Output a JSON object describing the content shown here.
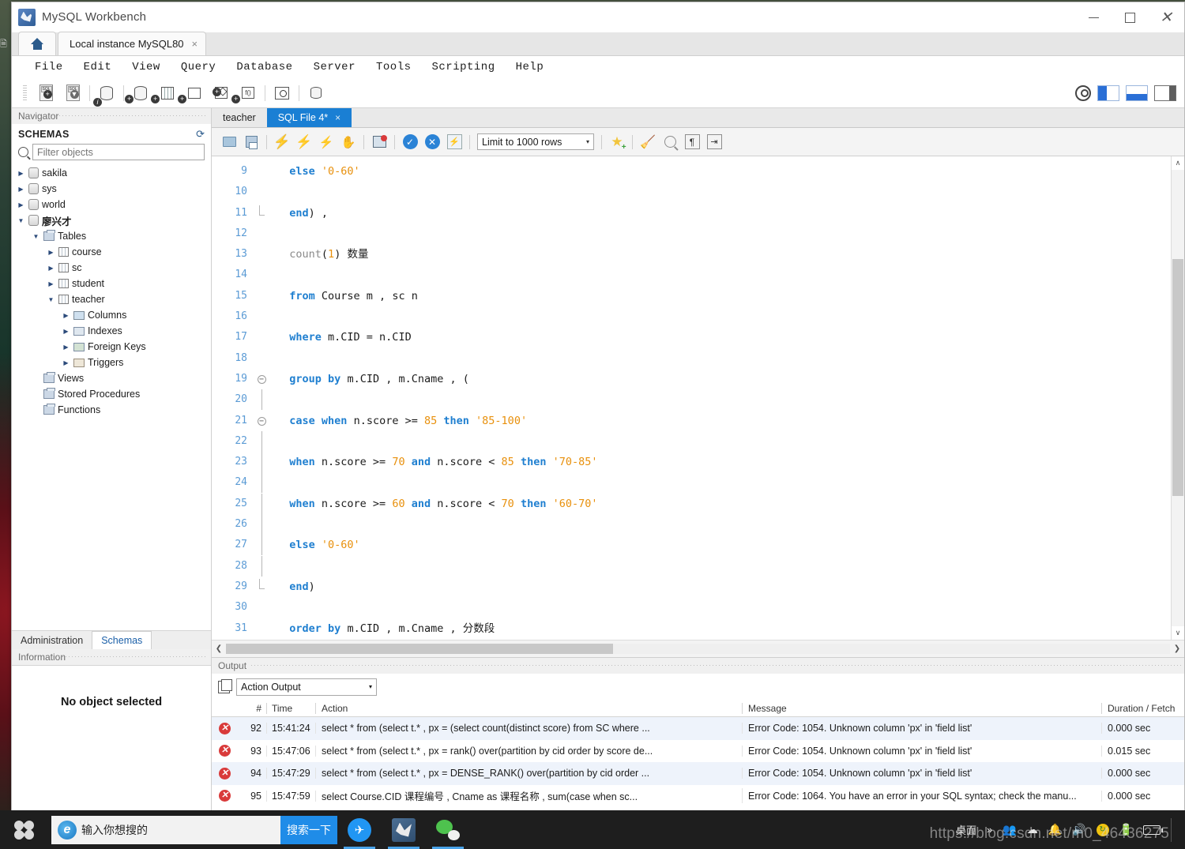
{
  "window": {
    "title": "MySQL Workbench",
    "controls": {
      "minimize": "—",
      "maximize": "□",
      "close": "✕"
    }
  },
  "connection_tabs": {
    "home_label": "home-tab",
    "active_tab": "Local instance MySQL80",
    "close_glyph": "×"
  },
  "menubar": {
    "items": [
      "File",
      "Edit",
      "View",
      "Query",
      "Database",
      "Server",
      "Tools",
      "Scripting",
      "Help"
    ]
  },
  "main_toolbar": {
    "icons": [
      "new-sql-tab-icon",
      "open-sql-script-icon",
      "connection-info-icon",
      "new-schema-icon",
      "new-table-icon",
      "new-view-icon",
      "new-procedure-icon",
      "new-function-icon",
      "search-data-icon",
      "reverse-engineer-icon"
    ],
    "right_icons": [
      "account-icon",
      "toggle-sidebar-icon",
      "toggle-output-icon",
      "toggle-secondary-sidebar-icon"
    ]
  },
  "navigator": {
    "panel_title": "Navigator",
    "section_title": "SCHEMAS",
    "refresh_icon": "refresh-icon",
    "filter_placeholder": "Filter objects",
    "filter_value": "",
    "tree": [
      {
        "label": "sakila",
        "indent": 0,
        "state": "closed",
        "icon": "schema-icon",
        "bold": false
      },
      {
        "label": "sys",
        "indent": 0,
        "state": "closed",
        "icon": "schema-icon",
        "bold": false
      },
      {
        "label": "world",
        "indent": 0,
        "state": "closed",
        "icon": "schema-icon",
        "bold": false
      },
      {
        "label": "廖兴才",
        "indent": 0,
        "state": "open",
        "icon": "schema-icon",
        "bold": true
      },
      {
        "label": "Tables",
        "indent": 1,
        "state": "open",
        "icon": "folder-icon",
        "bold": false
      },
      {
        "label": "course",
        "indent": 2,
        "state": "closed",
        "icon": "table-icon",
        "bold": false
      },
      {
        "label": "sc",
        "indent": 2,
        "state": "closed",
        "icon": "table-icon",
        "bold": false
      },
      {
        "label": "student",
        "indent": 2,
        "state": "closed",
        "icon": "table-icon",
        "bold": false
      },
      {
        "label": "teacher",
        "indent": 2,
        "state": "open",
        "icon": "table-icon",
        "bold": false
      },
      {
        "label": "Columns",
        "indent": 3,
        "state": "closed",
        "icon": "columns-icon",
        "bold": false
      },
      {
        "label": "Indexes",
        "indent": 3,
        "state": "closed",
        "icon": "indexes-icon",
        "bold": false
      },
      {
        "label": "Foreign Keys",
        "indent": 3,
        "state": "closed",
        "icon": "foreign-keys-icon",
        "bold": false
      },
      {
        "label": "Triggers",
        "indent": 3,
        "state": "closed",
        "icon": "triggers-icon",
        "bold": false
      },
      {
        "label": "Views",
        "indent": 1,
        "state": "none",
        "icon": "folder-icon",
        "bold": false
      },
      {
        "label": "Stored Procedures",
        "indent": 1,
        "state": "none",
        "icon": "folder-icon",
        "bold": false
      },
      {
        "label": "Functions",
        "indent": 1,
        "state": "none",
        "icon": "folder-icon",
        "bold": false
      }
    ],
    "bottom_tabs": [
      {
        "label": "Administration",
        "active": false
      },
      {
        "label": "Schemas",
        "active": true
      }
    ],
    "information_title": "Information",
    "information_body": "No object selected"
  },
  "editor": {
    "tabs": [
      {
        "label": "teacher",
        "active": false,
        "closable": false
      },
      {
        "label": "SQL File 4*",
        "active": true,
        "closable": true
      }
    ],
    "close_glyph": "×",
    "toolbar": {
      "limit_label": "Limit to 1000 rows",
      "dropdown_glyph": "▾",
      "icons": [
        "open-file-icon",
        "save-file-icon",
        "execute-icon",
        "execute-current-icon",
        "explain-icon",
        "stop-icon",
        "stop-on-error-icon",
        "commit-icon",
        "rollback-icon",
        "autocommit-icon",
        "star-icon",
        "beautify-icon",
        "find-icon",
        "toggle-invisible-chars-icon",
        "toggle-wrapping-icon"
      ]
    },
    "first_line_number": 9,
    "lines": [
      {
        "n": 9,
        "fold": "",
        "tokens": [
          {
            "t": "else",
            "c": "kw"
          },
          {
            "t": " ",
            "c": "pn"
          },
          {
            "t": "'0-60'",
            "c": "str"
          }
        ],
        "indent": 1
      },
      {
        "n": 10,
        "fold": "",
        "tokens": [],
        "indent": 1
      },
      {
        "n": 11,
        "fold": "end",
        "tokens": [
          {
            "t": "end",
            "c": "kw"
          },
          {
            "t": ") ,",
            "c": "pn"
          }
        ],
        "indent": 1
      },
      {
        "n": 12,
        "fold": "",
        "tokens": [],
        "indent": 0
      },
      {
        "n": 13,
        "fold": "",
        "tokens": [
          {
            "t": "count",
            "c": "fn"
          },
          {
            "t": "(",
            "c": "pn"
          },
          {
            "t": "1",
            "c": "num"
          },
          {
            "t": ") 数量",
            "c": "pn"
          }
        ],
        "indent": 1
      },
      {
        "n": 14,
        "fold": "",
        "tokens": [],
        "indent": 0
      },
      {
        "n": 15,
        "fold": "",
        "tokens": [
          {
            "t": "from",
            "c": "kw"
          },
          {
            "t": " Course m , sc n",
            "c": "pn"
          }
        ],
        "indent": 1
      },
      {
        "n": 16,
        "fold": "",
        "tokens": [],
        "indent": 0
      },
      {
        "n": 17,
        "fold": "",
        "tokens": [
          {
            "t": "where",
            "c": "kw"
          },
          {
            "t": " m.CID = n.CID",
            "c": "pn"
          }
        ],
        "indent": 1
      },
      {
        "n": 18,
        "fold": "",
        "tokens": [],
        "indent": 0
      },
      {
        "n": 19,
        "fold": "open",
        "tokens": [
          {
            "t": "group",
            "c": "kw"
          },
          {
            "t": " ",
            "c": "pn"
          },
          {
            "t": "by",
            "c": "kw"
          },
          {
            "t": " m.CID , m.Cname , (",
            "c": "pn"
          }
        ],
        "indent": 1
      },
      {
        "n": 20,
        "fold": "bar",
        "tokens": [],
        "indent": 0
      },
      {
        "n": 21,
        "fold": "open",
        "tokens": [
          {
            "t": "case",
            "c": "kw"
          },
          {
            "t": " ",
            "c": "pn"
          },
          {
            "t": "when",
            "c": "kw"
          },
          {
            "t": " n.score >= ",
            "c": "pn"
          },
          {
            "t": "85",
            "c": "num"
          },
          {
            "t": " ",
            "c": "pn"
          },
          {
            "t": "then",
            "c": "kw"
          },
          {
            "t": " ",
            "c": "pn"
          },
          {
            "t": "'85-100'",
            "c": "str"
          }
        ],
        "indent": 1
      },
      {
        "n": 22,
        "fold": "bar",
        "tokens": [],
        "indent": 0
      },
      {
        "n": 23,
        "fold": "bar",
        "tokens": [
          {
            "t": "when",
            "c": "kw"
          },
          {
            "t": " n.score >= ",
            "c": "pn"
          },
          {
            "t": "70",
            "c": "num"
          },
          {
            "t": " ",
            "c": "pn"
          },
          {
            "t": "and",
            "c": "kw"
          },
          {
            "t": " n.score < ",
            "c": "pn"
          },
          {
            "t": "85",
            "c": "num"
          },
          {
            "t": " ",
            "c": "pn"
          },
          {
            "t": "then",
            "c": "kw"
          },
          {
            "t": " ",
            "c": "pn"
          },
          {
            "t": "'70-85'",
            "c": "str"
          }
        ],
        "indent": 1
      },
      {
        "n": 24,
        "fold": "bar",
        "tokens": [],
        "indent": 0
      },
      {
        "n": 25,
        "fold": "bar",
        "tokens": [
          {
            "t": "when",
            "c": "kw"
          },
          {
            "t": " n.score >= ",
            "c": "pn"
          },
          {
            "t": "60",
            "c": "num"
          },
          {
            "t": " ",
            "c": "pn"
          },
          {
            "t": "and",
            "c": "kw"
          },
          {
            "t": " n.score < ",
            "c": "pn"
          },
          {
            "t": "70",
            "c": "num"
          },
          {
            "t": " ",
            "c": "pn"
          },
          {
            "t": "then",
            "c": "kw"
          },
          {
            "t": " ",
            "c": "pn"
          },
          {
            "t": "'60-70'",
            "c": "str"
          }
        ],
        "indent": 1
      },
      {
        "n": 26,
        "fold": "bar",
        "tokens": [],
        "indent": 0
      },
      {
        "n": 27,
        "fold": "bar",
        "tokens": [
          {
            "t": "else",
            "c": "kw"
          },
          {
            "t": " ",
            "c": "pn"
          },
          {
            "t": "'0-60'",
            "c": "str"
          }
        ],
        "indent": 1
      },
      {
        "n": 28,
        "fold": "bar",
        "tokens": [],
        "indent": 0
      },
      {
        "n": 29,
        "fold": "end",
        "tokens": [
          {
            "t": "end",
            "c": "kw"
          },
          {
            "t": ")",
            "c": "pn"
          }
        ],
        "indent": 1
      },
      {
        "n": 30,
        "fold": "",
        "tokens": [],
        "indent": 0
      },
      {
        "n": 31,
        "fold": "",
        "tokens": [
          {
            "t": "order",
            "c": "kw"
          },
          {
            "t": " ",
            "c": "pn"
          },
          {
            "t": "by",
            "c": "kw"
          },
          {
            "t": " m.CID , m.Cname , 分数段",
            "c": "pn"
          }
        ],
        "indent": 1
      }
    ]
  },
  "output": {
    "panel_title": "Output",
    "selector_value": "Action Output",
    "selector_glyph": "▾",
    "copy_icon": "copy-icon",
    "columns": [
      "#",
      "Time",
      "Action",
      "Message",
      "Duration / Fetch"
    ],
    "rows": [
      {
        "status": "error",
        "num": "92",
        "time": "15:41:24",
        "action": "select * from (select t.* , px = (select count(distinct score) from SC where ...",
        "message": "Error Code: 1054. Unknown column 'px' in 'field list'",
        "duration": "0.000 sec"
      },
      {
        "status": "error",
        "num": "93",
        "time": "15:47:06",
        "action": "select * from (select t.* , px = rank() over(partition by cid order by score de...",
        "message": "Error Code: 1054. Unknown column 'px' in 'field list'",
        "duration": "0.015 sec"
      },
      {
        "status": "error",
        "num": "94",
        "time": "15:47:29",
        "action": "select * from (select t.* , px = DENSE_RANK() over(partition by cid order ...",
        "message": "Error Code: 1054. Unknown column 'px' in 'field list'",
        "duration": "0.000 sec"
      },
      {
        "status": "error",
        "num": "95",
        "time": "15:47:59",
        "action": "select Course.CID 课程编号 , Cname as 课程名称 , sum(case when sc...",
        "message": "Error Code: 1064. You have an error in your SQL syntax; check the manu...",
        "duration": "0.000 sec"
      }
    ]
  },
  "taskbar": {
    "start_icon": "start-icon",
    "search_placeholder": "输入你想搜的",
    "search_button": "搜索一下",
    "apps": [
      "dingtalk-icon",
      "mysql-workbench-icon",
      "wechat-icon"
    ],
    "tray_label": "桌面",
    "tray_chevron": "»",
    "tray_icons": [
      "people-icon",
      "onedrive-icon",
      "notification-bell-icon",
      "volume-icon",
      "update-icon",
      "power-icon",
      "network-icon"
    ]
  },
  "watermark": "https://blog.csdn.net/m0_46436275",
  "colors": {
    "accent_blue": "#1a7fd4",
    "keyword_blue": "#1f7fd0",
    "string_orange": "#e8900c",
    "line_number_blue": "#5b9bd5",
    "error_red": "#d93a3a",
    "taskbar_dark": "#1e1e1e",
    "search_button_blue": "#1f8ce8"
  }
}
